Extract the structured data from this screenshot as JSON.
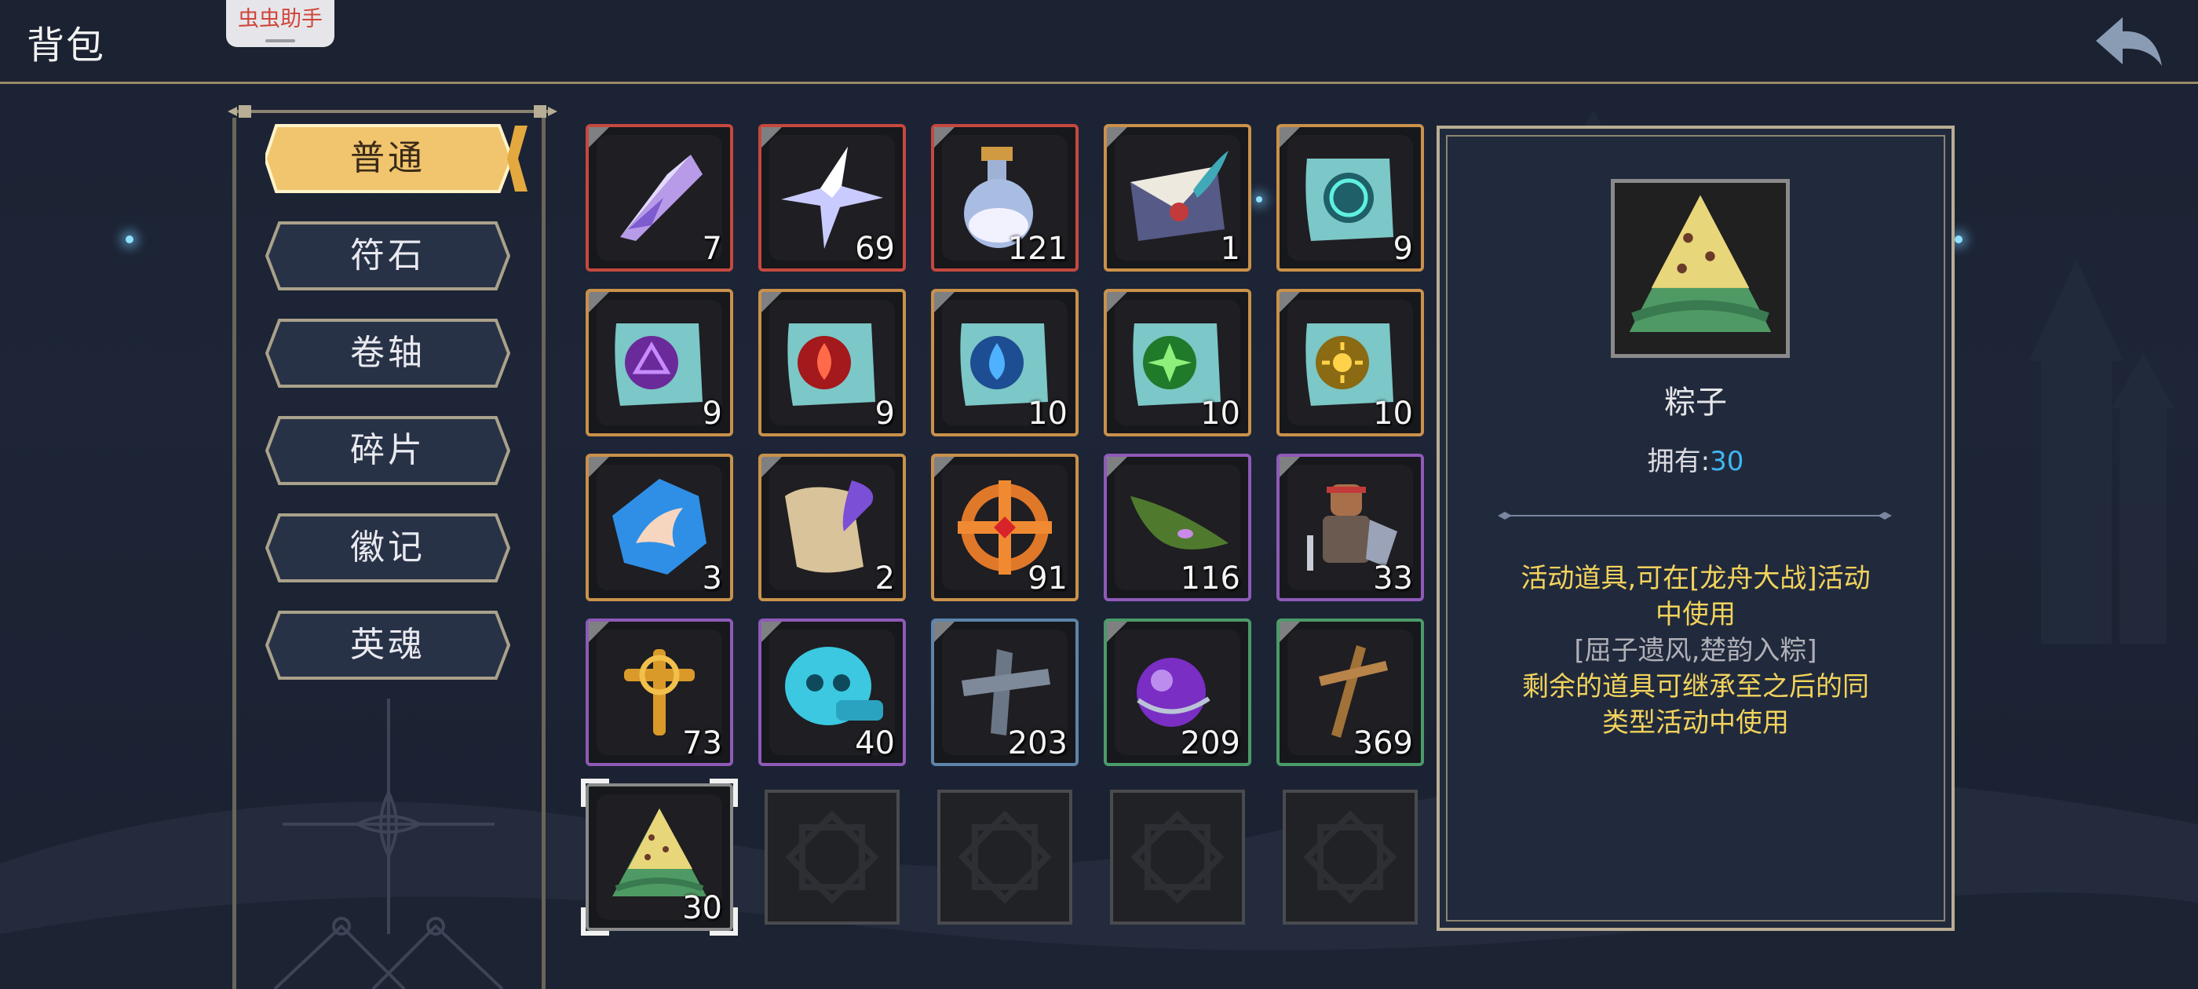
{
  "header": {
    "title": "背包",
    "overlay_badge": "虫虫助手"
  },
  "sidebar": {
    "tabs": [
      {
        "label": "普通",
        "active": true
      },
      {
        "label": "符石",
        "active": false
      },
      {
        "label": "卷轴",
        "active": false
      },
      {
        "label": "碎片",
        "active": false
      },
      {
        "label": "徽记",
        "active": false
      },
      {
        "label": "英魂",
        "active": false
      }
    ]
  },
  "inventory": {
    "items": [
      {
        "icon": "crystal-feather-icon",
        "rarity": "red",
        "count": "7"
      },
      {
        "icon": "star-crystal-icon",
        "rarity": "red",
        "count": "69"
      },
      {
        "icon": "potion-bottle-icon",
        "rarity": "red",
        "count": "121"
      },
      {
        "icon": "sealed-letter-icon",
        "rarity": "orange",
        "count": "1"
      },
      {
        "icon": "cyan-rune-scroll-icon",
        "rarity": "orange",
        "count": "9"
      },
      {
        "icon": "purple-rune-scroll-icon",
        "rarity": "orange",
        "count": "9"
      },
      {
        "icon": "red-fire-scroll-icon",
        "rarity": "orange",
        "count": "9"
      },
      {
        "icon": "blue-water-scroll-icon",
        "rarity": "orange",
        "count": "10"
      },
      {
        "icon": "green-leaf-scroll-icon",
        "rarity": "orange",
        "count": "10"
      },
      {
        "icon": "gold-sun-scroll-icon",
        "rarity": "orange",
        "count": "10"
      },
      {
        "icon": "blue-wing-emblem-icon",
        "rarity": "orange",
        "count": "3"
      },
      {
        "icon": "parchment-quill-icon",
        "rarity": "orange",
        "count": "2"
      },
      {
        "icon": "orange-rune-wheel-icon",
        "rarity": "orange",
        "count": "91"
      },
      {
        "icon": "green-leaf-icon",
        "rarity": "purple",
        "count": "116"
      },
      {
        "icon": "warrior-figure-icon",
        "rarity": "purple",
        "count": "33"
      },
      {
        "icon": "golden-cross-icon",
        "rarity": "purple",
        "count": "73"
      },
      {
        "icon": "cyan-skull-token-icon",
        "rarity": "purple",
        "count": "40"
      },
      {
        "icon": "stone-cross-icon",
        "rarity": "blue",
        "count": "203"
      },
      {
        "icon": "purple-orb-icon",
        "rarity": "green",
        "count": "209"
      },
      {
        "icon": "wooden-cross-icon",
        "rarity": "green",
        "count": "369"
      },
      {
        "icon": "zongzi-icon",
        "rarity": "selected",
        "count": "30"
      }
    ],
    "empty_slots": 4
  },
  "detail": {
    "name": "粽子",
    "own_label": "拥有:",
    "own_value": "30",
    "desc_line1": "活动道具,可在[龙舟大战]活动",
    "desc_line2": "中使用",
    "desc_line3": "[屈子遗风,楚韵入粽]",
    "desc_line4": "剩余的道具可继承至之后的同",
    "desc_line5": "类型活动中使用"
  },
  "colors": {
    "rarity_red": "#c5483f",
    "rarity_orange": "#c9914a",
    "rarity_purple": "#8e5ab8",
    "rarity_blue": "#5d84aa",
    "rarity_green": "#4b9a6a",
    "own_value": "#3fb6f2",
    "desc_gold": "#f2d35c"
  }
}
